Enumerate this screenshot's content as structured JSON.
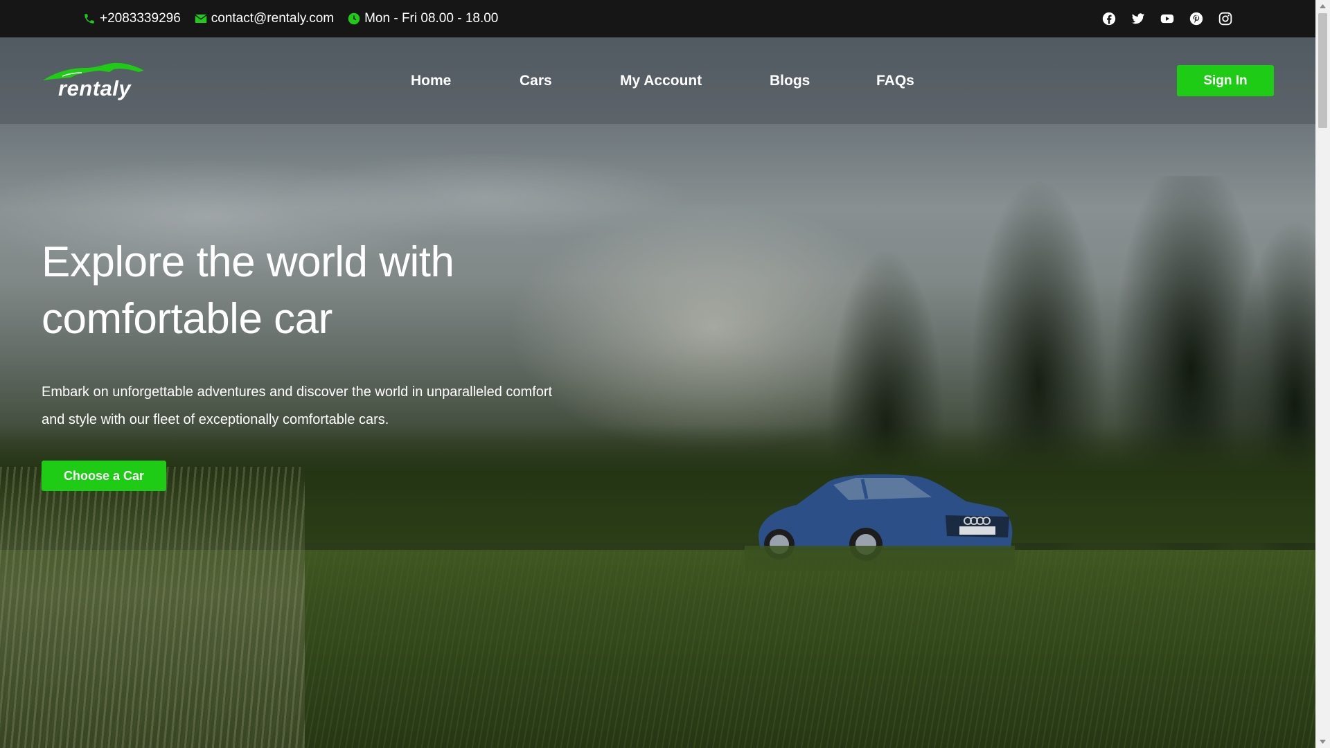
{
  "topbar": {
    "phone": "+2083339296",
    "email": "contact@rentaly.com",
    "hours": "Mon - Fri 08.00 - 18.00",
    "social": [
      "facebook-icon",
      "twitter-icon",
      "youtube-icon",
      "pinterest-icon",
      "instagram-icon"
    ]
  },
  "brand": {
    "name": "rentaly",
    "accent_color": "#1ecb15"
  },
  "nav": {
    "items": [
      "Home",
      "Cars",
      "My Account",
      "Blogs",
      "FAQs"
    ],
    "signin_label": "Sign In"
  },
  "hero": {
    "title_line1": "Explore the world with",
    "title_line2": "comfortable car",
    "desc_line1": "Embark on unforgettable adventures and discover the world in unparalleled comfort",
    "desc_line2": "and style with our fleet of exceptionally comfortable cars.",
    "cta_label": "Choose a Car"
  }
}
